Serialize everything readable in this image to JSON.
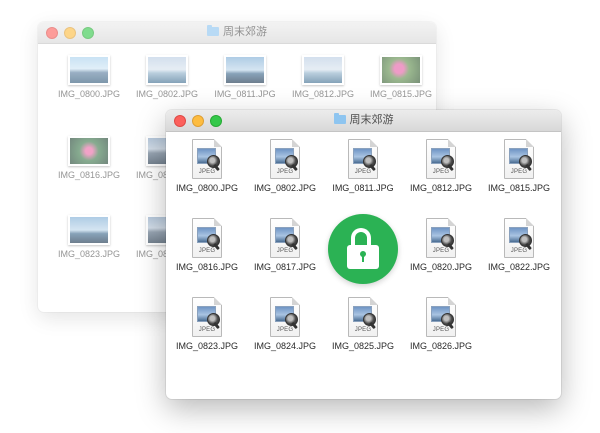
{
  "back_window": {
    "title": "周末郊游",
    "items": [
      {
        "name": "IMG_0800.JPG",
        "thumb": "t-lake"
      },
      {
        "name": "IMG_0802.JPG",
        "thumb": "t-boat"
      },
      {
        "name": "IMG_0811.JPG",
        "thumb": "t-pier"
      },
      {
        "name": "IMG_0812.JPG",
        "thumb": "t-boat"
      },
      {
        "name": "IMG_0815.JPG",
        "thumb": "t-flower"
      },
      {
        "name": "IMG_0816.JPG",
        "thumb": "t-lotus"
      },
      {
        "name": "IMG_0817.JPG",
        "thumb": "t-city"
      },
      {
        "name": "IMG_0823.JPG",
        "thumb": "t-pier"
      },
      {
        "name": "IMG_0824.JPG",
        "thumb": "t-city"
      }
    ]
  },
  "front_window": {
    "title": "周末郊游",
    "file_tag": "JPEG",
    "items": [
      {
        "name": "IMG_0800.JPG"
      },
      {
        "name": "IMG_0802.JPG"
      },
      {
        "name": "IMG_0811.JPG"
      },
      {
        "name": "IMG_0812.JPG"
      },
      {
        "name": "IMG_0815.JPG"
      },
      {
        "name": "IMG_0816.JPG"
      },
      {
        "name": "IMG_0817.JPG"
      },
      {
        "name": "IMG_0820.JPG"
      },
      {
        "name": "IMG_0822.JPG"
      },
      {
        "name": "IMG_0823.JPG"
      },
      {
        "name": "IMG_0824.JPG"
      },
      {
        "name": "IMG_0825.JPG"
      },
      {
        "name": "IMG_0826.JPG"
      }
    ]
  },
  "lock_badge": {
    "icon": "lock-icon",
    "color": "#2bb254"
  }
}
